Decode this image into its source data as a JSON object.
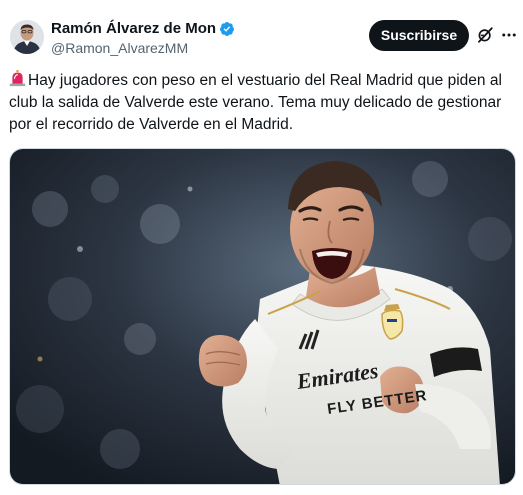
{
  "author": {
    "display_name": "Ramón Álvarez de Mon",
    "handle": "@Ramon_AlvarezMM",
    "verified": true
  },
  "actions": {
    "subscribe_label": "Suscribirse"
  },
  "tweet": {
    "text": "Hay jugadores con peso en el vestuario del Real Madrid que piden al club la salida de Valverde este verano. Tema muy delicado de gestionar por el recorrido de Valverde en el Madrid.",
    "lead_icon": "rotating-light-icon"
  },
  "media": {
    "jersey_sponsor_line1": "Emirates",
    "jersey_sponsor_line2": "FLY BETTER"
  },
  "colors": {
    "verified_blue": "#1d9bf0",
    "button_bg": "#0f1419",
    "handle_gray": "#536471",
    "alert_red": "#e0245e"
  },
  "icons": [
    "verified-badge-icon",
    "grok-icon",
    "more-icon",
    "rotating-light-icon"
  ]
}
